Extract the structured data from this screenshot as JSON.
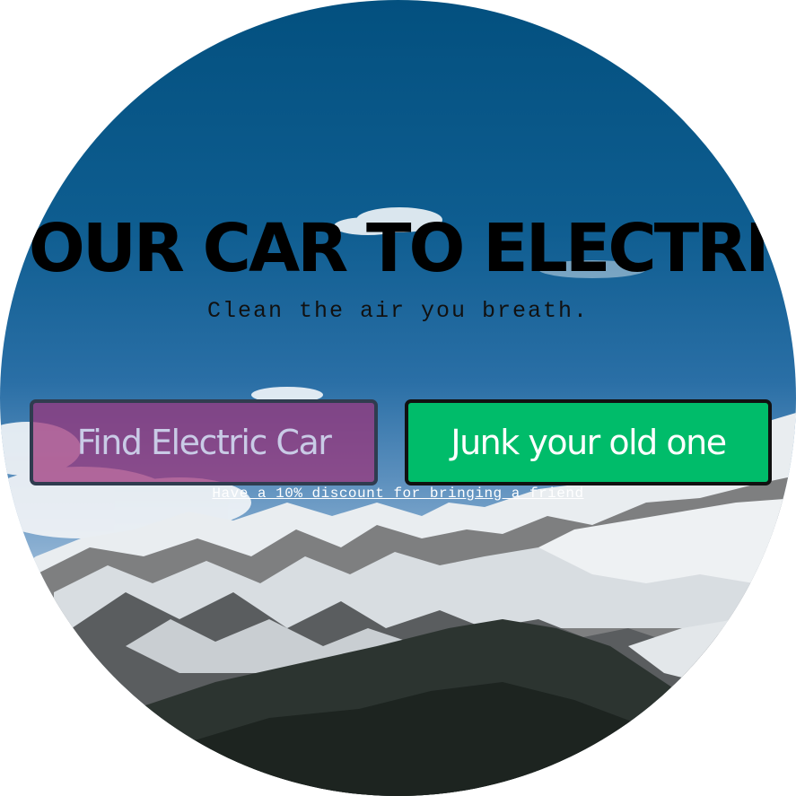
{
  "hero": {
    "headline": "YOUR CAR TO ELECTRIC",
    "tagline": "Clean the air you breath."
  },
  "actions": {
    "find_label": "Find Electric Car",
    "junk_label": "Junk your old one",
    "discount_text": "Have a 10% discount for bringing a friend"
  },
  "colors": {
    "sky_top": "#03507f",
    "find_button_bg": "#9b3278",
    "junk_button_bg": "#00bc6a",
    "headline_text": "#000000"
  },
  "background_image": "snowy-mountain-landscape"
}
